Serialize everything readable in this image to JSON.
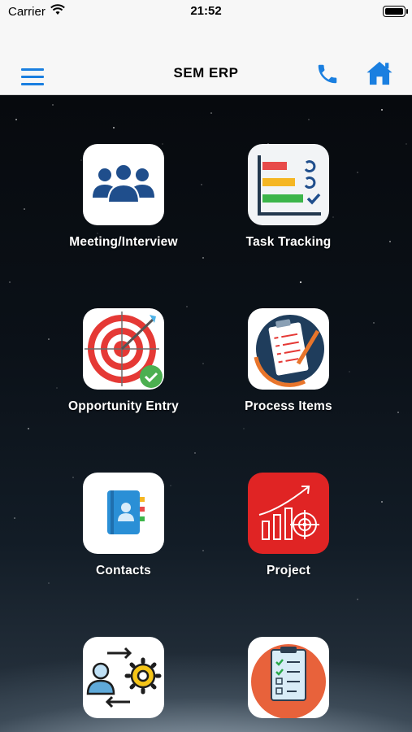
{
  "status": {
    "carrier": "Carrier",
    "time": "21:52"
  },
  "nav": {
    "title": "SEM ERP",
    "menu_icon": "hamburger-menu-icon",
    "phone_icon": "phone-icon",
    "home_icon": "home-icon"
  },
  "tiles": [
    {
      "label": "Meeting/Interview",
      "icon": "people-group-icon"
    },
    {
      "label": "Task Tracking",
      "icon": "task-chart-icon"
    },
    {
      "label": "Opportunity Entry",
      "icon": "target-icon"
    },
    {
      "label": "Process Items",
      "icon": "clipboard-checklist-icon"
    },
    {
      "label": "Contacts",
      "icon": "contact-book-icon"
    },
    {
      "label": "Project",
      "icon": "growth-chart-target-icon"
    },
    {
      "label": "",
      "icon": "user-settings-icon"
    },
    {
      "label": "",
      "icon": "checklist-icon"
    }
  ],
  "colors": {
    "accent": "#1a7fe0",
    "nav_bg": "#f7f7f7",
    "project_tile": "#e02424"
  }
}
